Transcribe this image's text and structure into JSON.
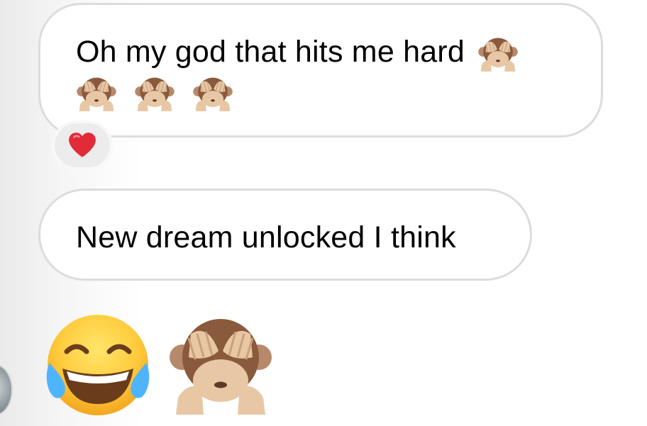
{
  "messages": [
    {
      "text_line1": "Oh my god that hits me hard",
      "line1_emoji": "see-no-evil-monkey",
      "line2_emojis": [
        "see-no-evil-monkey",
        "see-no-evil-monkey",
        "see-no-evil-monkey"
      ],
      "reaction": "red-heart"
    },
    {
      "text_line1": "New dream unlocked I think"
    }
  ],
  "big_emojis": [
    "face-with-tears-of-joy",
    "see-no-evil-monkey"
  ],
  "colors": {
    "bubble_border": "#dcdcdc",
    "bubble_background": "#ffffff",
    "reaction_background": "#ececec",
    "heart_red": "#e12b38"
  }
}
